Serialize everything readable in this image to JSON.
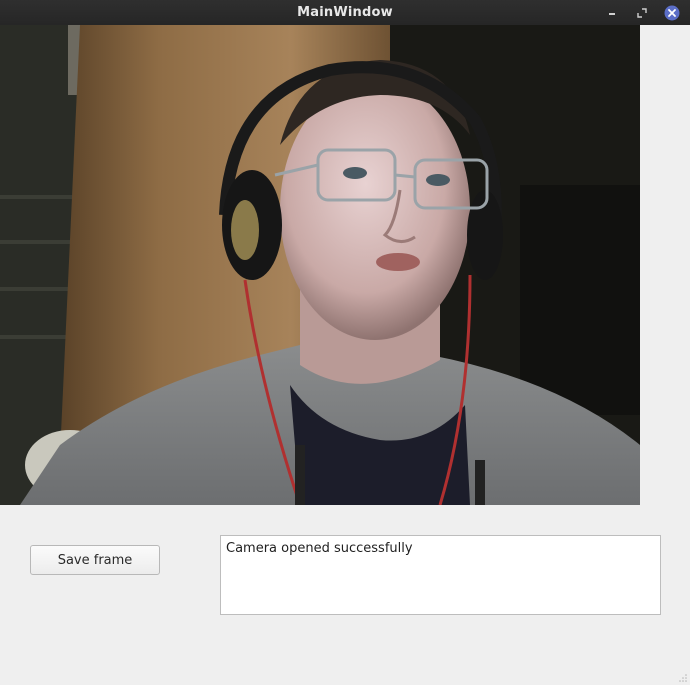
{
  "window": {
    "title": "MainWindow",
    "controls": {
      "minimize_icon": "minimize-icon",
      "maximize_icon": "maximize-icon",
      "close_icon": "close-icon"
    },
    "close_color": "#5b6ec7"
  },
  "camera": {
    "feed": "webcam-frame"
  },
  "controls": {
    "save_label": "Save frame"
  },
  "log": {
    "text": "Camera opened successfully"
  }
}
